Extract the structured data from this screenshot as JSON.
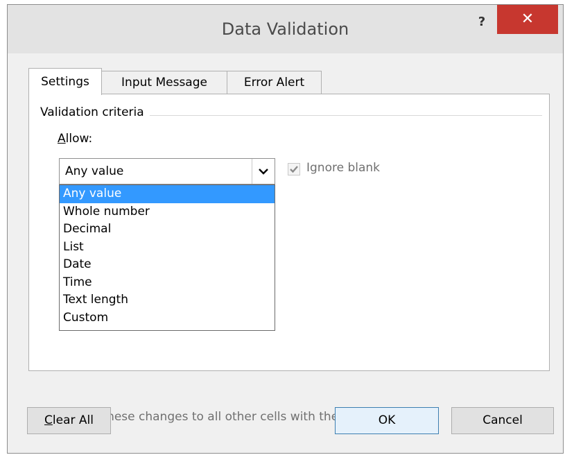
{
  "window": {
    "title": "Data Validation",
    "help_label": "?",
    "close_label": "✕"
  },
  "tabs": [
    {
      "label": "Settings",
      "active": true
    },
    {
      "label": "Input Message",
      "active": false
    },
    {
      "label": "Error Alert",
      "active": false
    }
  ],
  "settings": {
    "section_label": "Validation criteria",
    "allow_label_first": "A",
    "allow_label_rest": "llow:",
    "allow_value": "Any value",
    "allow_options": [
      "Any value",
      "Whole number",
      "Decimal",
      "List",
      "Date",
      "Time",
      "Text length",
      "Custom"
    ],
    "selected_option": "Any value",
    "ignore_blank_label": "Ignore blank",
    "ignore_blank_checked": true,
    "apply_all_label": "Apply these changes to all other cells with the same settings",
    "apply_all_checked": false
  },
  "buttons": {
    "clear_all_first": "C",
    "clear_all_rest": "lear All",
    "ok": "OK",
    "cancel": "Cancel"
  },
  "colors": {
    "selection": "#3399ff",
    "close_button": "#c7372f"
  }
}
